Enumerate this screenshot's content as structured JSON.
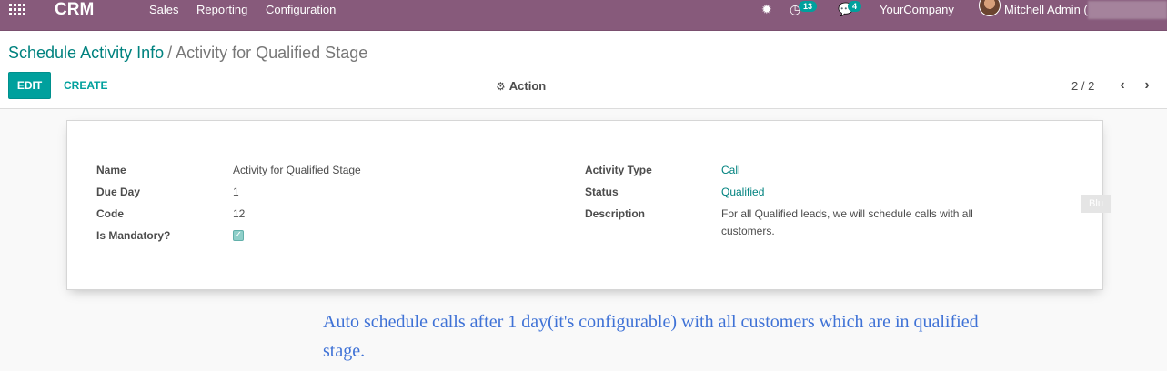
{
  "topbar": {
    "app_name": "CRM",
    "menu": [
      "Sales",
      "Reporting",
      "Configuration"
    ],
    "activity_count": "13",
    "message_count": "4",
    "company": "YourCompany",
    "user": "Mitchell Admin ("
  },
  "breadcrumb": {
    "parent": "Schedule Activity Info",
    "separator": "/",
    "current": "Activity for Qualified Stage"
  },
  "toolbar": {
    "edit_label": "EDIT",
    "create_label": "CREATE",
    "action_label": "Action",
    "pager": "2 / 2"
  },
  "form": {
    "name_label": "Name",
    "name_value": "Activity for Qualified Stage",
    "due_day_label": "Due Day",
    "due_day_value": "1",
    "code_label": "Code",
    "code_value": "12",
    "mandatory_label": "Is Mandatory?",
    "mandatory_checked": true,
    "activity_type_label": "Activity Type",
    "activity_type_value": "Call",
    "status_label": "Status",
    "status_value": "Qualified",
    "description_label": "Description",
    "description_value": "For all Qualified leads, we will schedule calls with all customers."
  },
  "side_tag": "Blu",
  "caption": "Auto schedule calls after 1 day(it's configurable) with all customers which are in qualified stage.",
  "colors": {
    "topbar": "#875a7b",
    "accent": "#00a09d",
    "caption": "#3f72d6"
  },
  "icons": [
    "apps-icon",
    "bug-icon",
    "clock-icon",
    "chat-icon",
    "gear-icon",
    "chevron-left-icon",
    "chevron-right-icon"
  ]
}
